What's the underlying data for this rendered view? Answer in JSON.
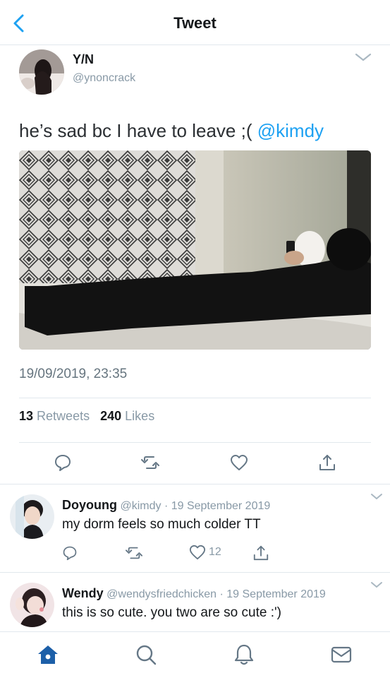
{
  "header": {
    "title": "Tweet",
    "back_icon": "back-chevron-icon"
  },
  "tweet": {
    "author_name": "Y/N",
    "author_handle": "@ynoncrack",
    "text": "he’s sad bc I have to leave ;(",
    "mention": "@kimdy",
    "timestamp": "19/09/2019, 23:35",
    "retweets_count": "13",
    "retweets_label": "Retweets",
    "likes_count": "240",
    "likes_label": "Likes"
  },
  "replies": [
    {
      "name": "Doyoung",
      "handle": "@kimdy",
      "separator": "·",
      "date": "19 September 2019",
      "text": "my dorm feels so much colder TT",
      "like_count": "12"
    },
    {
      "name": "Wendy",
      "handle": "@wendysfriedchicken",
      "separator": "·",
      "date": "19 September 2019",
      "text": "this is so cute. you two are so cute :')"
    }
  ],
  "colors": {
    "accent": "#1da1f2",
    "muted": "#8899a6",
    "nav_active": "#1c5fa8"
  },
  "nav": [
    "home-icon",
    "search-icon",
    "notifications-icon",
    "messages-icon"
  ]
}
